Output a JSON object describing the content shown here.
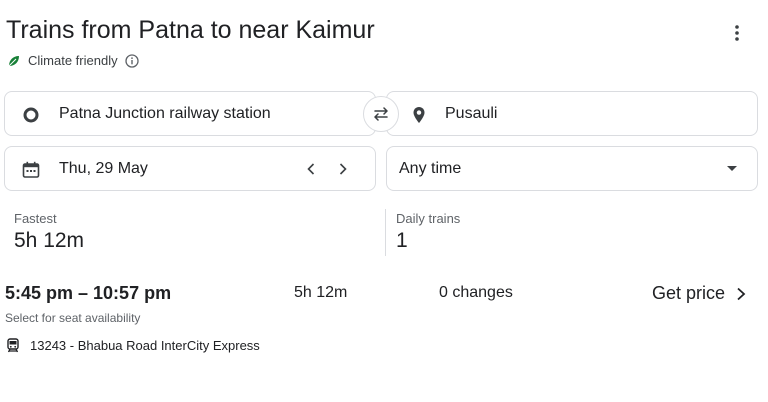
{
  "header": {
    "title": "Trains from Patna to near Kaimur",
    "climate_label": "Climate friendly",
    "more_icon": "more-vert-icon"
  },
  "search": {
    "origin": "Patna Junction railway station",
    "destination": "Pusauli",
    "date": "Thu, 29 May",
    "time": "Any time"
  },
  "stats": {
    "fastest_label": "Fastest",
    "fastest_value": "5h 12m",
    "daily_label": "Daily trains",
    "daily_value": "1"
  },
  "result": {
    "times": "5:45 pm – 10:57 pm",
    "duration": "5h 12m",
    "changes": "0 changes",
    "price_label": "Get price",
    "seat_note": "Select for seat availability",
    "train_name": "13243 - Bhabua Road InterCity Express"
  },
  "colors": {
    "leaf": "#188038",
    "text": "#202124",
    "secondary": "#5f6368",
    "border": "#dadce0"
  }
}
